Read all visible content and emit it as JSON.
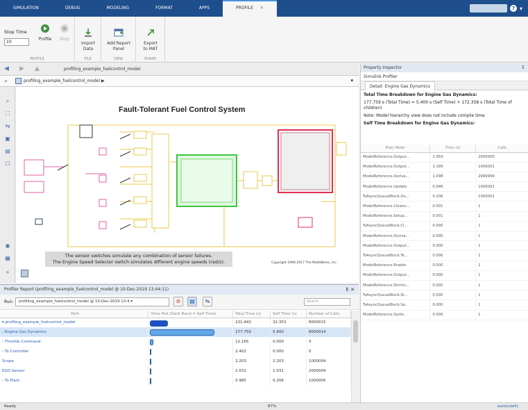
{
  "tabs": [
    {
      "label": "SIMULATION"
    },
    {
      "label": "DEBUG"
    },
    {
      "label": "MODELING"
    },
    {
      "label": "FORMAT"
    },
    {
      "label": "APPS"
    },
    {
      "label": "PROFILE",
      "active": true
    }
  ],
  "ribbon": {
    "stop_time_label": "Stop Time",
    "stop_time_value": "10",
    "profile_label": "Profile",
    "stop_label": "Stop",
    "import_label": "Import\nData",
    "add_report_label": "Add Report\nPanel",
    "export_label": "Export\nto MAT",
    "groups": {
      "profile": "PROFILE",
      "file": "FILE",
      "view": "VIEW",
      "share": "SHARE"
    }
  },
  "nav": {
    "breadcrumb": "profiling_example_fuelcontrol_model",
    "model_path": "profiling_example_fuelcontrol_model ▶"
  },
  "canvas": {
    "model_title": "Fault-Tolerant Fuel Control System",
    "note_line1": "The sensor switches simulate any combination of sensor failures.",
    "note_line2": "The Engine Speed Selector switch simulates different engine speeds (rad/s).",
    "copyright": "Copyright 1990-2017 The MathWorks, Inc."
  },
  "profiler": {
    "title": "Profiler Report (profiling_example_fuelcontrol_model @ 10-Dec-2019 13:44:11)",
    "run_label": "Run:",
    "run_value": "profiling_example_fuelcontrol_model @ 10-Dec-2019 13:4 ▾",
    "search_placeholder": "Search",
    "columns": [
      "Path",
      "Time Plot (Dark Band = Self Time)",
      "Total Time (s)",
      "Self Time (s)",
      "Number of Calls"
    ],
    "rows": [
      {
        "path": "▾ profiling_example_fuelcontrol_model",
        "bar": 0.22,
        "total": "231.443",
        "self": "32.353",
        "calls": "8000015"
      },
      {
        "path": "  › Engine Gas Dynamics",
        "bar": 0.8,
        "total": "177.759",
        "self": "5.400",
        "calls": "8000014",
        "selected": true
      },
      {
        "path": "  › Throttle Command",
        "bar": 0.04,
        "total": "12.165",
        "self": "0.000",
        "calls": "0"
      },
      {
        "path": "  › To Controller",
        "bar": 0.01,
        "total": "2.402",
        "self": "0.000",
        "calls": "0"
      },
      {
        "path": "    Scope",
        "bar": 0.01,
        "total": "2.203",
        "self": "2.203",
        "calls": "1000004"
      },
      {
        "path": "    EGO Sensor",
        "bar": 0.0,
        "total": "1.031",
        "self": "1.031",
        "calls": "2000009"
      },
      {
        "path": "  › To Plant",
        "bar": 0.0,
        "total": "0.985",
        "self": "0.206",
        "calls": "1000005"
      }
    ]
  },
  "inspector": {
    "title": "Property Inspector",
    "section": "Simulink Profiler",
    "detail_tab": "Detail: Engine Gas Dynamics",
    "total_heading": "Total Time Breakdown for Engine Gas Dynamics:",
    "total_text": "177.759 s (Total Time) = 5.400 s (Self Time) + 172.358 s (Total Time of children)",
    "note": "Note: Model hierarchy view does not include compile time",
    "self_heading": "Self Time Breakdown for Engine Gas Dynamics:",
    "columns": [
      "Exec Node",
      "Time (s)",
      "Calls"
    ],
    "rows": [
      [
        "ModelReference.Output...",
        "1.959",
        "2000000"
      ],
      [
        "ModelReference.Output...",
        "1.189",
        "1000001"
      ],
      [
        "ModelReference.Deriva...",
        "1.098",
        "2999999"
      ],
      [
        "ModelReference.Update",
        "0.946",
        "1000001"
      ],
      [
        "TsAsyncQueueBlock.Ou...",
        "0.206",
        "1000001"
      ],
      [
        "ModelReference.Cleanu...",
        "0.001",
        "1"
      ],
      [
        "ModelReference.Setup...",
        "0.001",
        "1"
      ],
      [
        "TsAsyncQueueBlock.Cl...",
        "0.000",
        "1"
      ],
      [
        "ModelReference.Deriva...",
        "0.000",
        "1"
      ],
      [
        "ModelReference.Output...",
        "0.000",
        "1"
      ],
      [
        "TsAsyncQueueBlock.Te...",
        "0.000",
        "1"
      ],
      [
        "ModelReference.Enable",
        "0.000",
        "1"
      ],
      [
        "ModelReference.Output...",
        "0.000",
        "1"
      ],
      [
        "ModelReference.Termin...",
        "0.000",
        "1"
      ],
      [
        "TsAsyncQueueBlock.St...",
        "0.000",
        "1"
      ],
      [
        "TsAsyncQueueBlock.Se...",
        "0.000",
        "1"
      ],
      [
        "ModelReference.Syste...",
        "0.000",
        "1"
      ]
    ]
  },
  "status": {
    "ready": "Ready",
    "zoom": "87%",
    "solver": "auto(ode5)"
  }
}
